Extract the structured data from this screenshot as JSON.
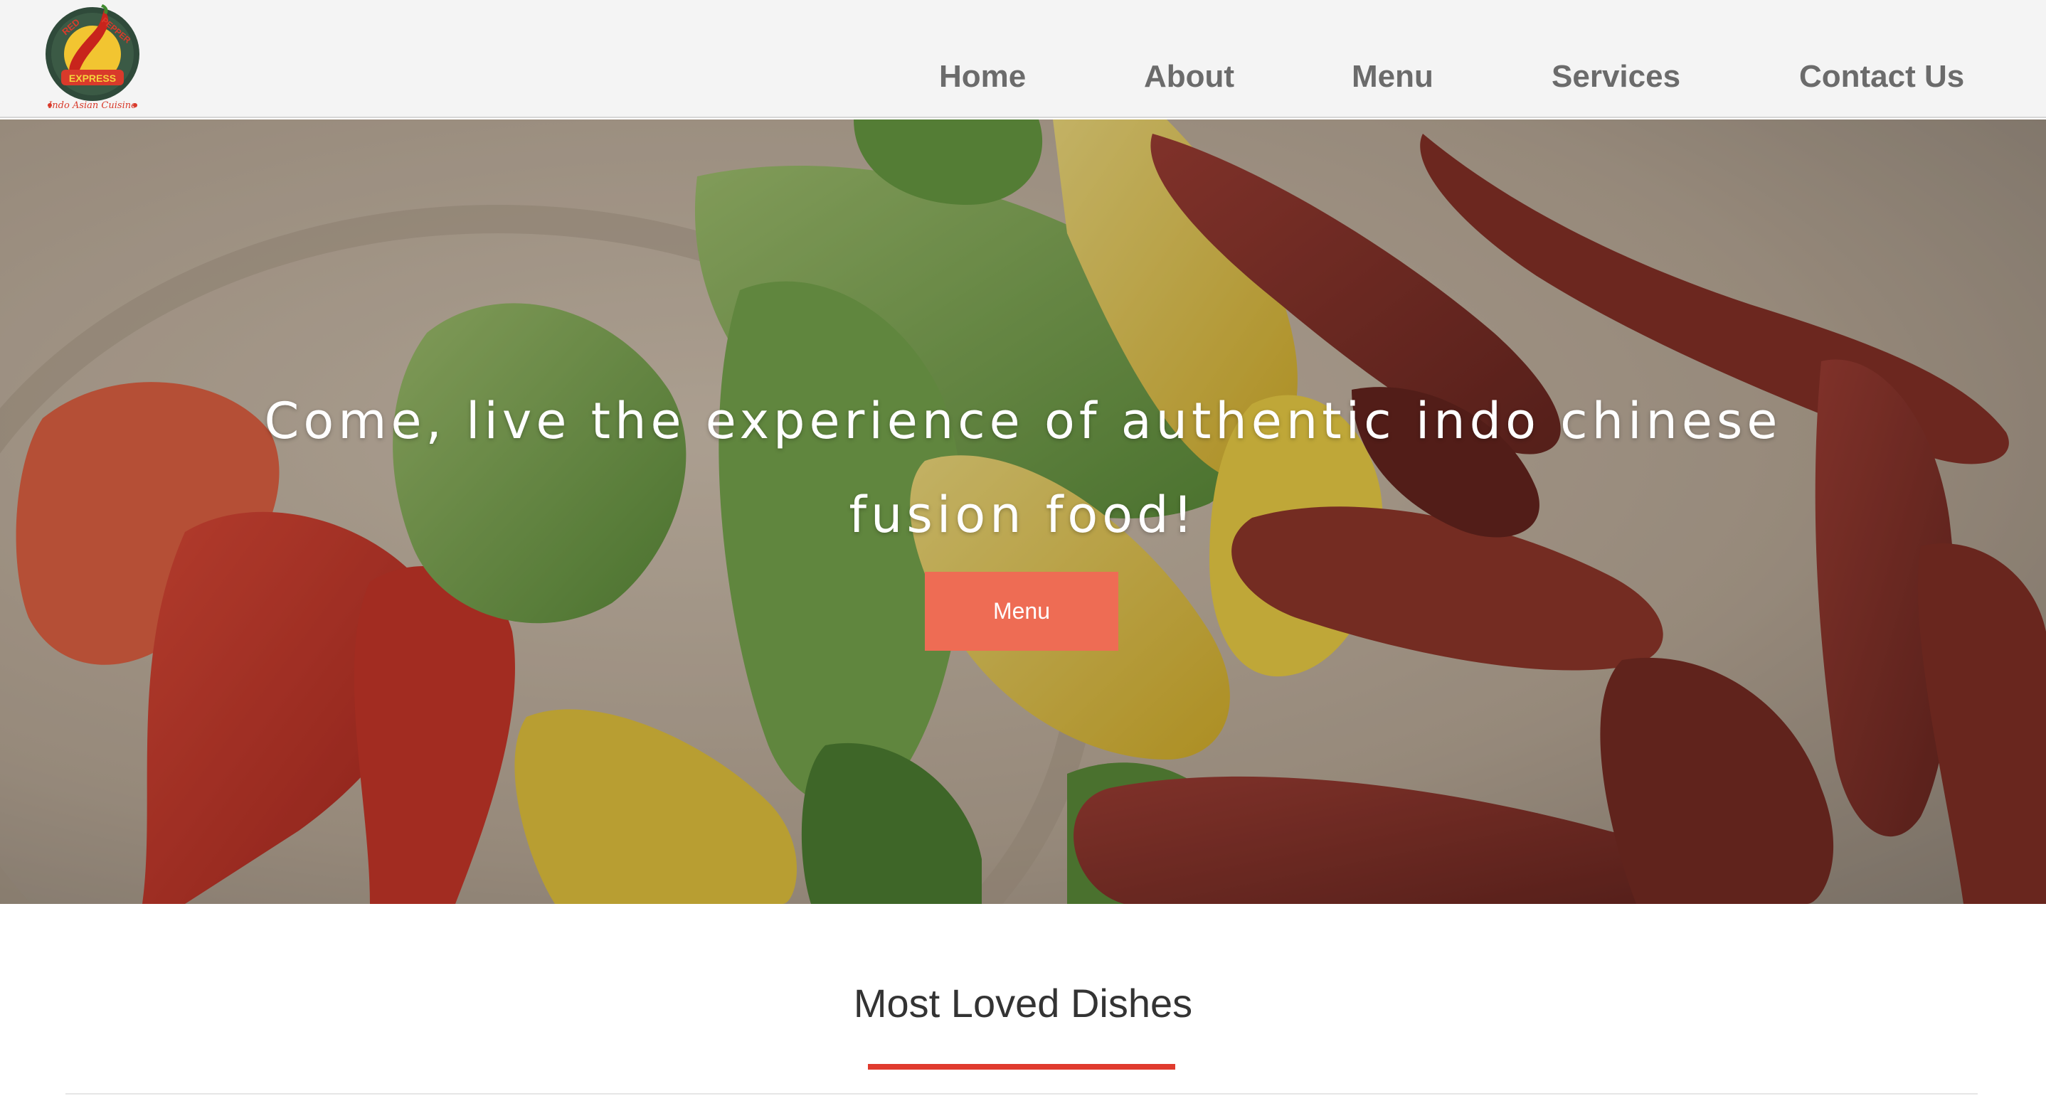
{
  "header": {
    "logo": {
      "text_top_left": "RED",
      "text_top_right": "PEPPER",
      "text_banner": "EXPRESS",
      "text_bottom": "Indo Asian Cuisine",
      "icon": "chili-pepper-icon"
    },
    "nav": [
      {
        "label": "Home"
      },
      {
        "label": "About"
      },
      {
        "label": "Menu"
      },
      {
        "label": "Services"
      },
      {
        "label": "Contact Us"
      }
    ]
  },
  "hero": {
    "title_line1": "Come, live the experience of authentic indo chinese",
    "title_line2": "fusion food!",
    "button_label": "Menu"
  },
  "section": {
    "title": "Most Loved Dishes"
  },
  "colors": {
    "accent": "#ee6c54",
    "underline": "#e03b2e",
    "nav_text": "#6b6b6b",
    "header_bg": "#f4f4f4"
  }
}
